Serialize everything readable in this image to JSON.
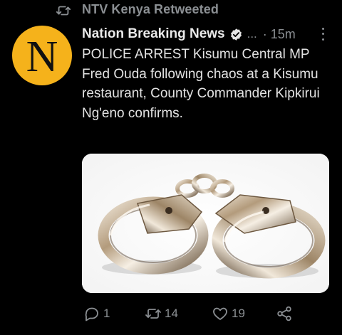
{
  "retweet": {
    "icon": "retweet-icon",
    "text": "NTV Kenya Retweeted"
  },
  "author": {
    "avatar_letter": "N",
    "avatar_color": "#f5b21b",
    "name": "Nation Breaking News",
    "verified_icon": "verified-badge-icon",
    "handle": "...",
    "time": "· 15m"
  },
  "tweet": {
    "text": "POLICE ARREST Kisumu Central MP Fred Ouda following chaos at a Kisumu restaurant, County Commander Kipkirui Ng'eno confirms."
  },
  "media": {
    "subject": "handcuffs"
  },
  "actions": {
    "replies": "1",
    "retweets": "14",
    "likes": "19"
  },
  "colors": {
    "background": "#000000",
    "muted": "#8b8f93",
    "text": "#e3e3e3"
  }
}
